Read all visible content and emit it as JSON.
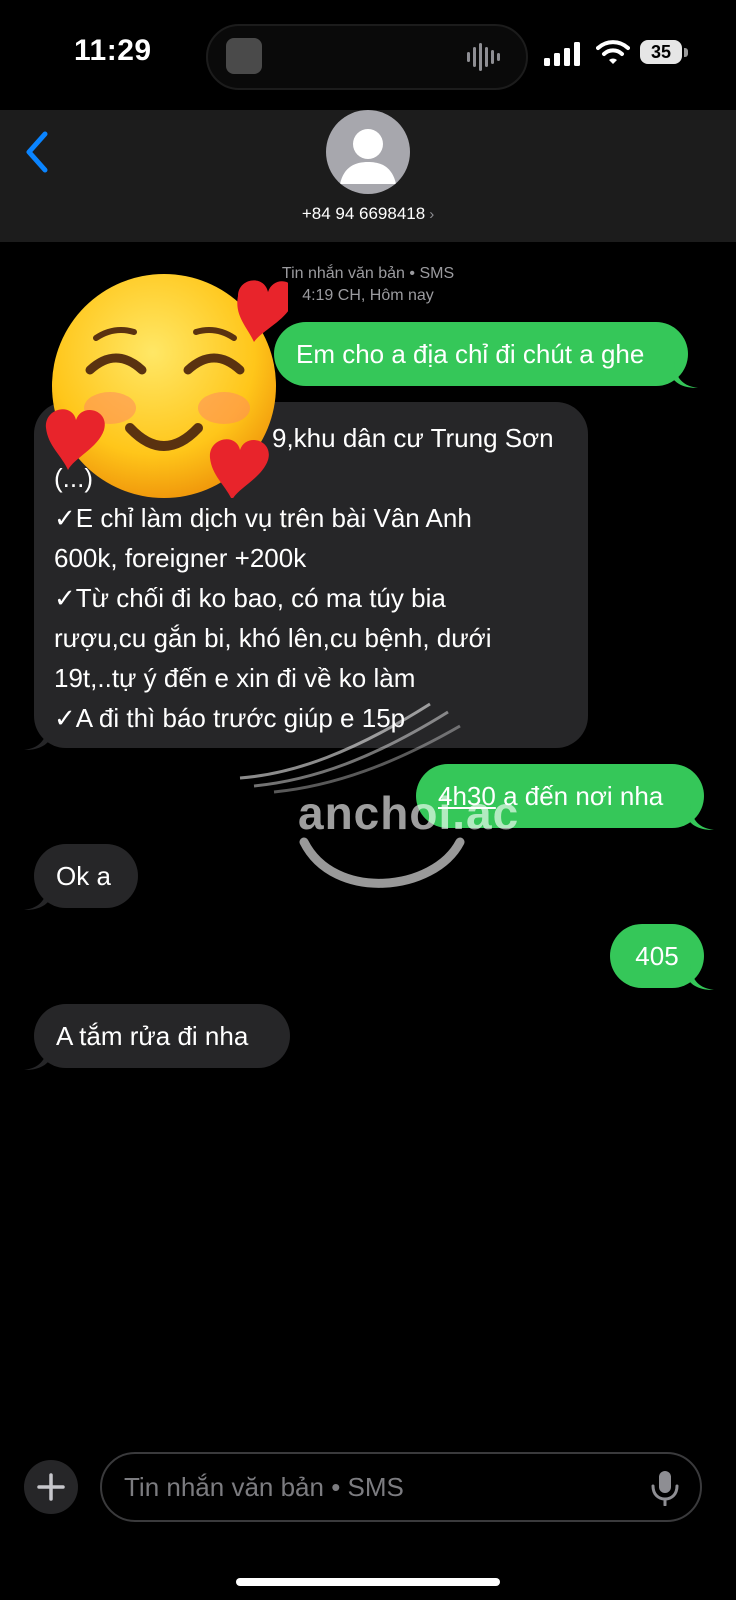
{
  "status_bar": {
    "time": "11:29",
    "battery": "35"
  },
  "header": {
    "contact": "+84 94 6698418",
    "chevron": "›"
  },
  "thread_meta": {
    "line1": "Tin nhắn văn bản • SMS",
    "line2": "4:19 CH, Hôm nay"
  },
  "messages": [
    {
      "side": "sent",
      "lines": [
        "Em cho a địa chỉ đi chút a ghe"
      ]
    },
    {
      "side": "received",
      "lines": [
        "9,khu dân cư Trung Sơn",
        "(...)",
        "✓E chỉ làm dịch vụ trên bài Vân Anh",
        "600k, foreigner +200k",
        "✓Từ chối đi ko bao, có ma túy bia",
        "rượu,cu gắn bi, khó lên,cu bệnh, dưới",
        "19t,..tự ý đến e xin đi về ko làm",
        "✓A đi thì báo trước giúp e 15p"
      ]
    },
    {
      "side": "sent",
      "underlined": "4h30",
      "rest": " a đến nơi nha"
    },
    {
      "side": "received",
      "lines": [
        "Ok a"
      ]
    },
    {
      "side": "sent",
      "lines": [
        "405"
      ]
    },
    {
      "side": "received",
      "lines": [
        "A tắm rửa đi nha"
      ]
    }
  ],
  "watermark": {
    "text": "anchoi.ac"
  },
  "composer": {
    "placeholder": "Tin nhắn văn bản • SMS",
    "value": ""
  },
  "colors": {
    "sent_bubble": "#35c759",
    "received_bubble": "#262628",
    "accent_blue": "#0a84ff",
    "background": "#000000"
  },
  "icons": [
    "back-chevron-icon",
    "contact-avatar-icon",
    "signal-icon",
    "wifi-icon",
    "battery-icon",
    "plus-icon",
    "microphone-icon",
    "smiling-face-with-hearts-emoji"
  ]
}
